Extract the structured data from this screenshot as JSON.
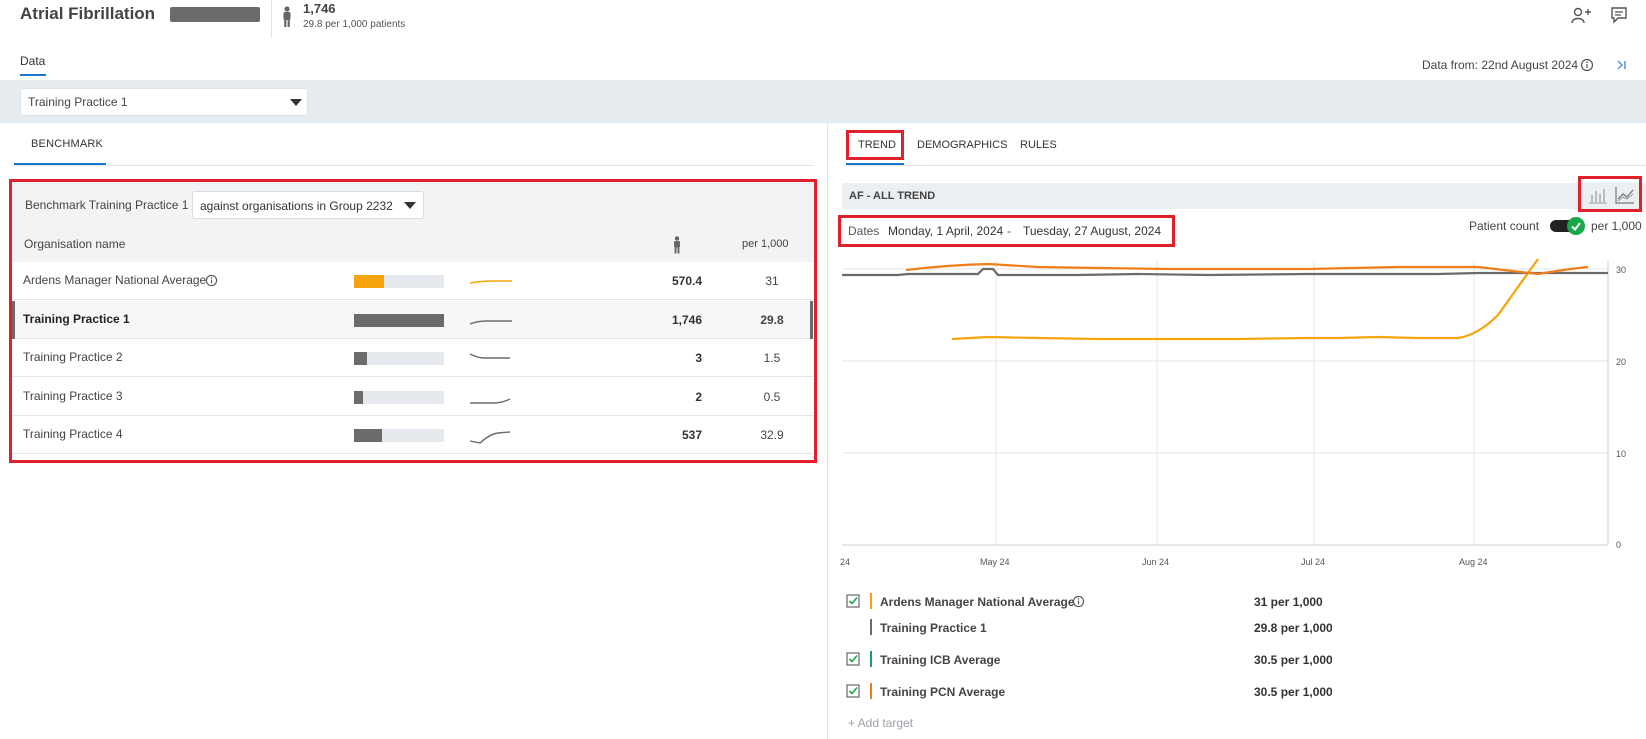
{
  "header": {
    "title": "Atrial Fibrillation",
    "patient_count": "1,746",
    "patient_count_sub": "29.8 per 1,000 patients"
  },
  "data_tab": "Data",
  "data_from": "Data from: 22nd August 2024",
  "practice_select": {
    "value": "Training Practice 1"
  },
  "benchmark": {
    "tab": "BENCHMARK",
    "label": "Benchmark Training Practice 1",
    "group_select": "against organisations in Group 2232",
    "columns": {
      "org": "Organisation name",
      "rate": "per 1,000"
    },
    "rows": [
      {
        "name": "Ardens Manager National Average",
        "count": "570.4",
        "rate": "31",
        "bar": 0.33,
        "color": "#f5a40c",
        "has_info": true
      },
      {
        "name": "Training Practice 1",
        "count": "1,746",
        "rate": "29.8",
        "bar": 1.0,
        "color": "#6b6b6b",
        "selected": true
      },
      {
        "name": "Training Practice 2",
        "count": "3",
        "rate": "1.5",
        "bar": 0.14,
        "color": "#6b6b6b"
      },
      {
        "name": "Training Practice 3",
        "count": "2",
        "rate": "0.5",
        "bar": 0.1,
        "color": "#6b6b6b"
      },
      {
        "name": "Training Practice 4",
        "count": "537",
        "rate": "32.9",
        "bar": 0.31,
        "color": "#6b6b6b"
      }
    ]
  },
  "right_tabs": [
    "TREND",
    "DEMOGRAPHICS",
    "RULES"
  ],
  "trend": {
    "title": "AF - ALL TREND",
    "dates_label": "Dates",
    "date_from": "Monday, 1 April, 2024",
    "date_sep": "-",
    "date_to": "Tuesday, 27 August, 2024",
    "patient_count_label": "Patient count",
    "per1000_label": "per 1,000",
    "add_target": "+ Add target"
  },
  "chart_data": {
    "type": "line",
    "y_ticks": [
      "30",
      "20",
      "10",
      "0"
    ],
    "ylim": [
      0,
      30
    ],
    "x_ticks": [
      "24",
      "May 24",
      "Jun 24",
      "Jul 24",
      "Aug 24"
    ],
    "series": [
      {
        "name": "Ardens Manager National Average",
        "color": "#f5a40c",
        "value_label": "31 per 1,000",
        "checked": true
      },
      {
        "name": "Training Practice 1",
        "color": "#6b6b6b",
        "value_label": "29.8 per 1,000",
        "checked": false
      },
      {
        "name": "Training ICB Average",
        "color": "#1a9a8a",
        "value_label": "30.5 per 1,000",
        "checked": true
      },
      {
        "name": "Training PCN Average",
        "color": "#f07d1a",
        "value_label": "30.5 per 1,000",
        "checked": true
      }
    ]
  },
  "colors": {
    "accent": "#1976d2",
    "highlight": "#e2202c",
    "toggle_on": "#17a84a"
  }
}
